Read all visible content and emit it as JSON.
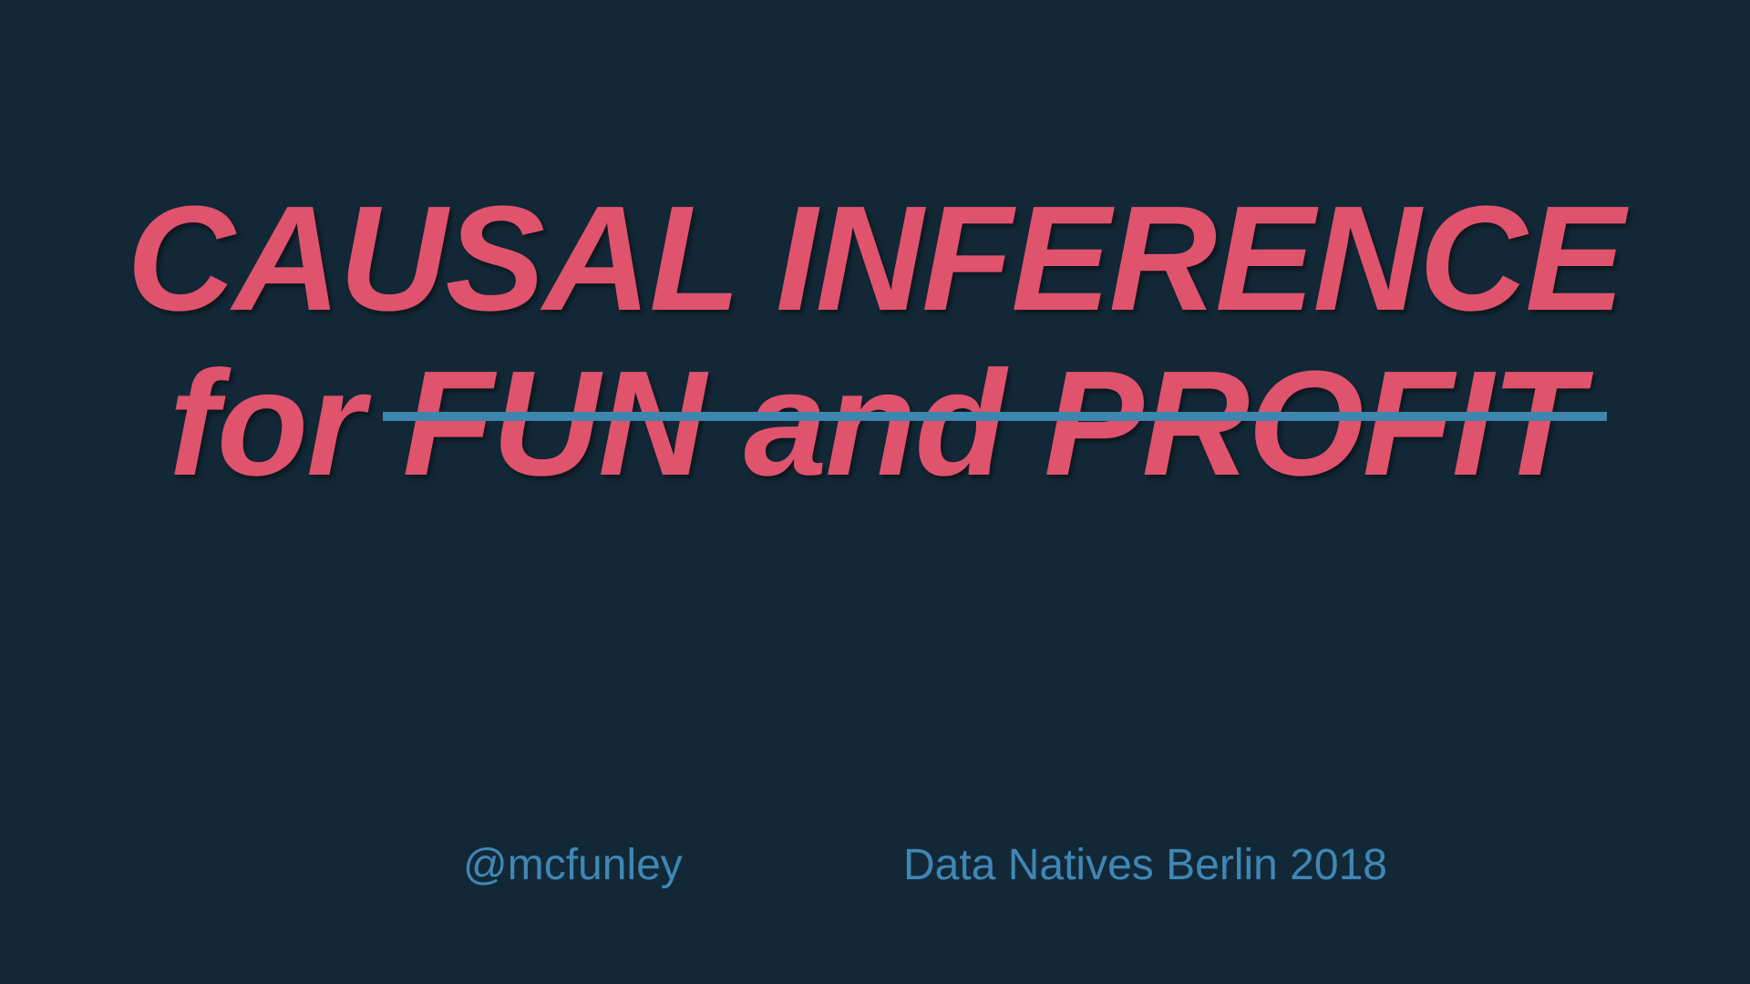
{
  "slide": {
    "title_line1": "CAUSAL INFERENCE",
    "title_line2_prefix": "for",
    "title_line2_struck": "FUN and PROFIT",
    "author_handle": "@mcfunley",
    "event": "Data Natives Berlin 2018"
  },
  "colors": {
    "background": "#132837",
    "title": "#e0536d",
    "strikethrough": "#3d86ad",
    "footer_text": "#3f87b5"
  }
}
